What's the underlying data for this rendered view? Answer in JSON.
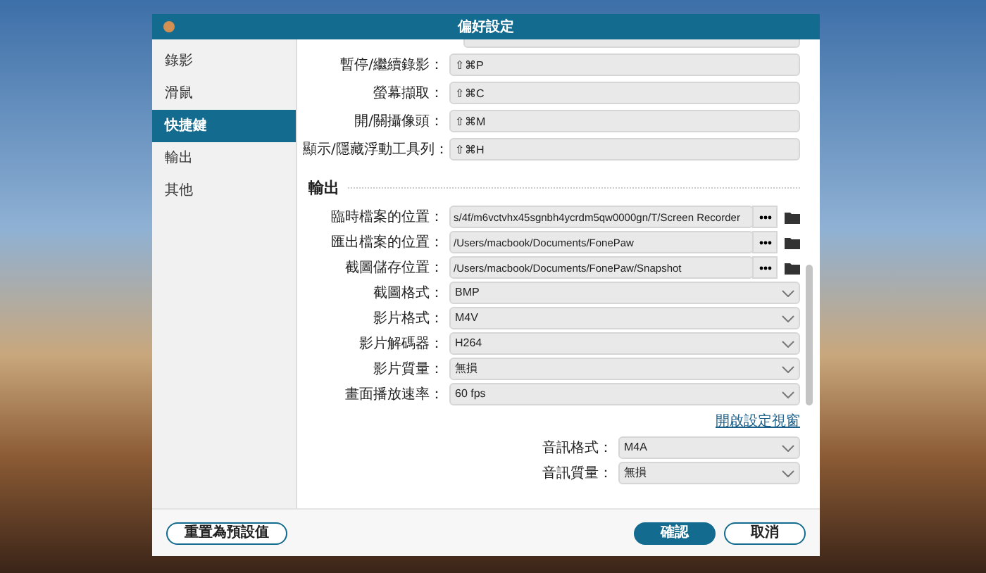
{
  "window": {
    "title": "偏好設定"
  },
  "sidebar": {
    "items": [
      {
        "label": "錄影",
        "selected": false
      },
      {
        "label": "滑鼠",
        "selected": false
      },
      {
        "label": "快捷鍵",
        "selected": true
      },
      {
        "label": "輸出",
        "selected": false
      },
      {
        "label": "其他",
        "selected": false
      }
    ]
  },
  "shortcuts": [
    {
      "label": "暫停/繼續錄影：",
      "value": "⇧⌘P"
    },
    {
      "label": "螢幕擷取：",
      "value": "⇧⌘C"
    },
    {
      "label": "開/關攝像頭：",
      "value": "⇧⌘M"
    },
    {
      "label": "顯示/隱藏浮動工具列：",
      "value": "⇧⌘H"
    }
  ],
  "output": {
    "title": "輸出",
    "fields": [
      {
        "kind": "path",
        "label": "臨時檔案的位置：",
        "value": "s/4f/m6vctvhx45sgnbh4ycrdm5qw0000gn/T/Screen Recorder"
      },
      {
        "kind": "path",
        "label": "匯出檔案的位置：",
        "value": "/Users/macbook/Documents/FonePaw"
      },
      {
        "kind": "path",
        "label": "截圖儲存位置：",
        "value": "/Users/macbook/Documents/FonePaw/Snapshot"
      },
      {
        "kind": "select",
        "label": "截圖格式：",
        "value": "BMP"
      },
      {
        "kind": "select",
        "label": "影片格式：",
        "value": "M4V"
      },
      {
        "kind": "select",
        "label": "影片解碼器：",
        "value": "H264"
      },
      {
        "kind": "select",
        "label": "影片質量：",
        "value": "無損"
      },
      {
        "kind": "select",
        "label": "畫面播放速率：",
        "value": "60 fps"
      }
    ],
    "link": "開啟設定視窗",
    "audio": [
      {
        "label": "音訊格式：",
        "value": "M4A"
      },
      {
        "label": "音訊質量：",
        "value": "無損"
      }
    ]
  },
  "buttons": {
    "reset": "重置為預設值",
    "confirm": "確認",
    "cancel": "取消"
  }
}
